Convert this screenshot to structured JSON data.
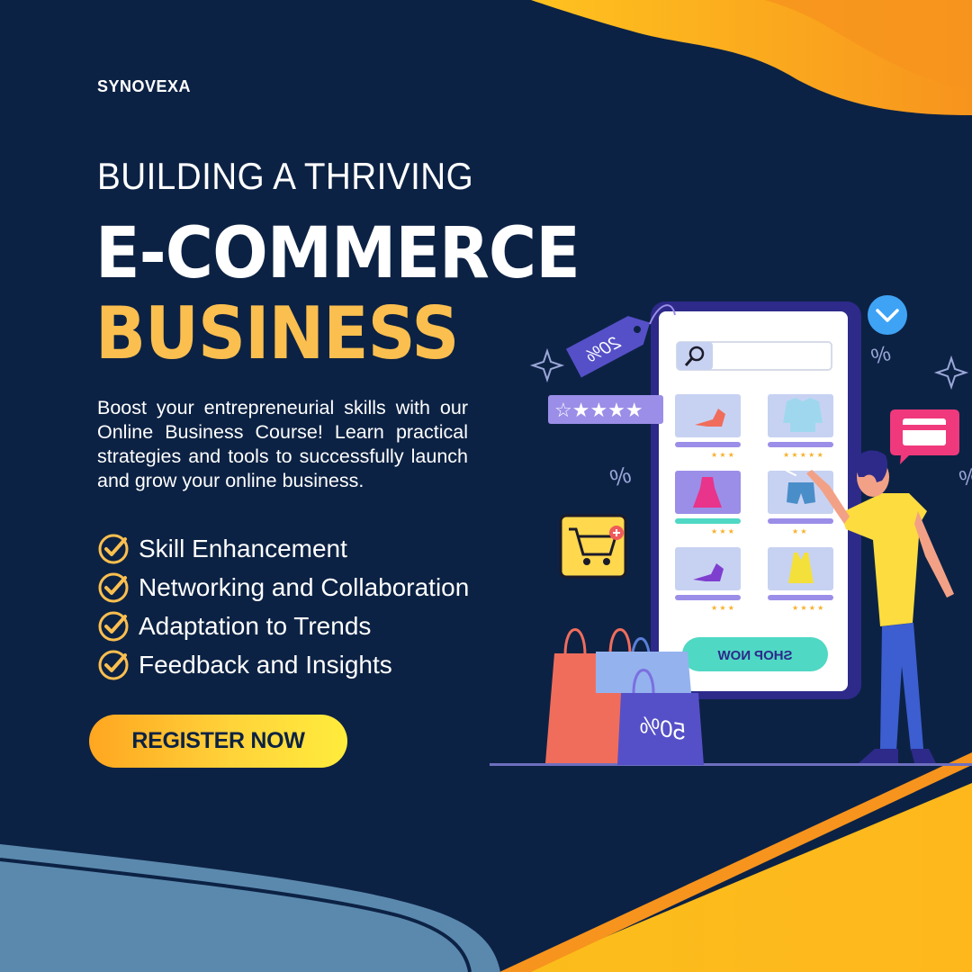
{
  "brand": "SYNOVEXA",
  "headline": {
    "line1": "BUILDING A THRIVING",
    "line2": "E-COMMERCE",
    "line3": "BUSINESS"
  },
  "description": "Boost your entrepreneurial skills with our Online Business Course! Learn practical strategies and tools to successfully launch and grow your online business.",
  "features": [
    "Skill Enhancement",
    "Networking and Collaboration",
    "Adaptation to Trends",
    "Feedback and Insights"
  ],
  "cta_label": "REGISTER NOW",
  "illustration": {
    "shop_button_label": "SHOP NOW",
    "price_tag_text": "20%",
    "bag_text": "50%",
    "icons": [
      "search-icon",
      "chevron-down-icon",
      "credit-card-icon",
      "shopping-cart-icon",
      "star-icon",
      "percent-icon",
      "sparkle-icon"
    ]
  },
  "colors": {
    "background": "#0c2244",
    "accent_yellow": "#fbbf4f",
    "orange": "#f7941d",
    "teal": "#4fd8c4",
    "purple": "#9b8ee8",
    "steel_blue": "#5b89ae"
  }
}
